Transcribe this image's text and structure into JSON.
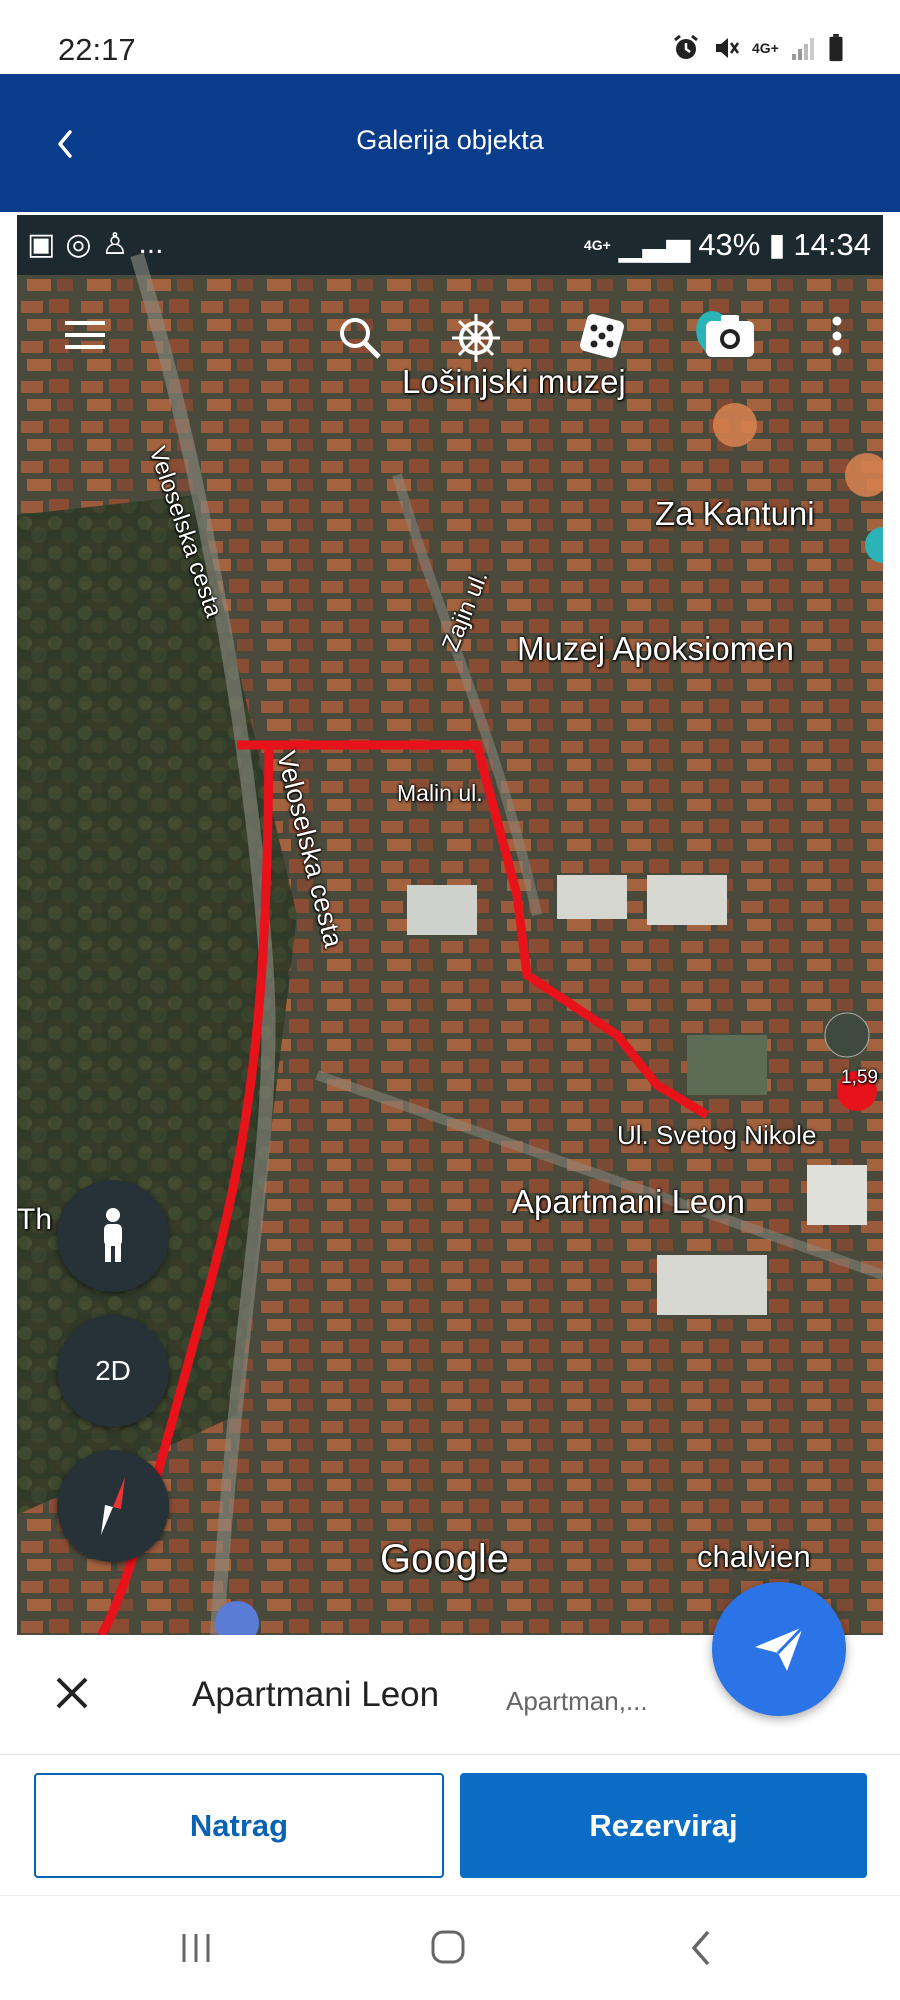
{
  "status_bar": {
    "time": "22:17",
    "network": "4G+",
    "icons": [
      "alarm-icon",
      "mute-icon",
      "signal-icon",
      "battery-icon"
    ]
  },
  "header": {
    "title": "Galerija objekta",
    "back_icon": "chevron-left-icon",
    "bg_color": "#0a3c8c"
  },
  "gallery": {
    "inner_status": {
      "time": "14:34",
      "battery": "43%",
      "network": "4G+",
      "left_more": "..."
    },
    "map_toolbar": [
      "menu-icon",
      "search-icon",
      "ship-wheel-icon",
      "dice-icon",
      "camera-icon",
      "more-vert-icon"
    ],
    "labels": {
      "losinjski_muzej": "Lošinjski muzej",
      "za_kantuni": "Za Kantuni",
      "zajin_ul": "Zajin ul.",
      "muzej_apoksiomen": "Muzej Apoksiomen",
      "veloselska_cesta_1": "Veloselska cesta",
      "veloselska_cesta_2": "Veloselska cesta",
      "malin_ul": "Malin ul.",
      "ul_svetog_nikole": "Ul. Svetog Nikole",
      "apartmani_leon": "Apartmani Leon",
      "th": "Th",
      "google": "Google",
      "chalvien": "chalvien",
      "badge": "1,59"
    },
    "controls": {
      "pegman_icon": "person-icon",
      "toggle_2d": "2D",
      "compass_icon": "compass-icon"
    },
    "route_color": "#e8121a"
  },
  "card": {
    "close_icon": "close-icon",
    "name": "Apartmani Leon",
    "subtitle": "Apartman,...",
    "fab_icon": "send-icon",
    "fab_color": "#2a74e8"
  },
  "actions": {
    "back_label": "Natrag",
    "book_label": "Rezerviraj"
  },
  "navbar": {
    "items": [
      "recent-apps-icon",
      "home-icon",
      "back-icon"
    ]
  }
}
